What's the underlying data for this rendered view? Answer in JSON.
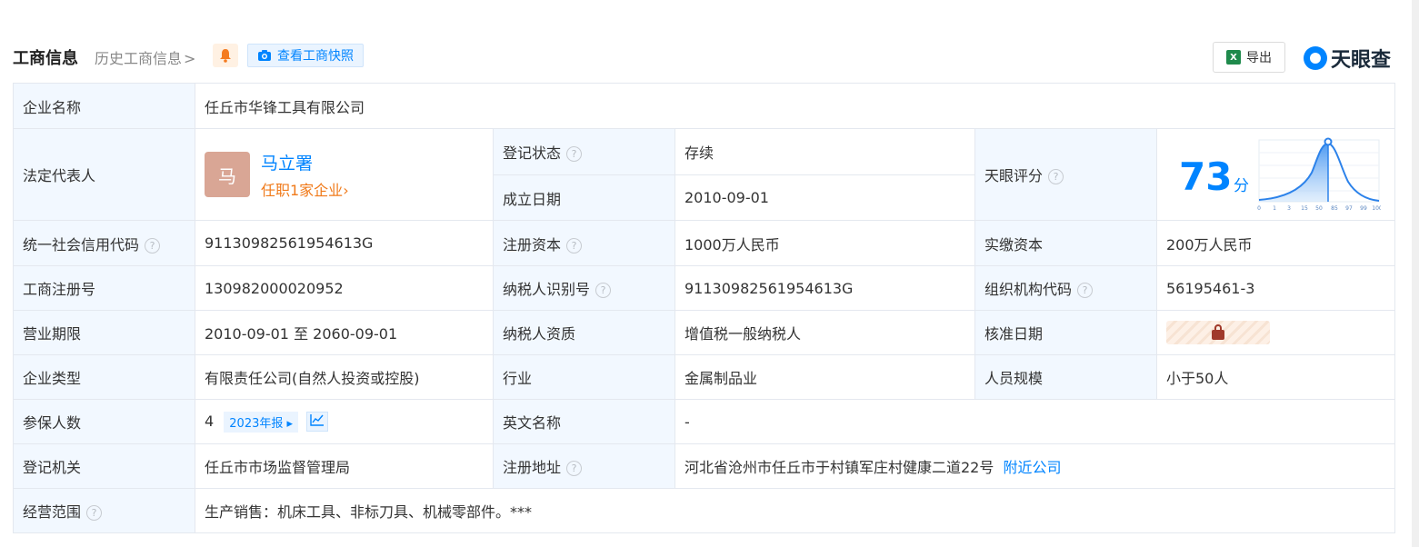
{
  "header": {
    "title": "工商信息",
    "history_label": "历史工商信息",
    "history_chevron": ">",
    "snapshot_label": "查看工商快照",
    "export_label": "导出",
    "brand_name": "天眼查"
  },
  "colors": {
    "accent": "#0084ff",
    "label_bg": "#f2f8ff",
    "status_green": "#1a9a4b",
    "orange": "#f07a1a"
  },
  "fields": {
    "company_name_label": "企业名称",
    "company_name": "任丘市华锋工具有限公司",
    "legal_rep_label": "法定代表人",
    "legal_rep_avatar": "马",
    "legal_rep_name": "马立署",
    "legal_rep_jobs": "任职1家企业",
    "legal_rep_jobs_chevron": "›",
    "reg_status_label": "登记状态",
    "reg_status": "存续",
    "founded_label": "成立日期",
    "founded": "2010-09-01",
    "score_label": "天眼评分",
    "score": "73",
    "score_unit": "分",
    "score_axis": [
      "0",
      "1",
      "3",
      "15",
      "50",
      "85",
      "97",
      "99",
      "100"
    ],
    "credit_code_label": "统一社会信用代码",
    "credit_code": "91130982561954613G",
    "reg_capital_label": "注册资本",
    "reg_capital": "1000万人民币",
    "paid_capital_label": "实缴资本",
    "paid_capital": "200万人民币",
    "reg_no_label": "工商注册号",
    "reg_no": "130982000020952",
    "taxpayer_id_label": "纳税人识别号",
    "taxpayer_id": "91130982561954613G",
    "org_code_label": "组织机构代码",
    "org_code": "56195461-3",
    "term_label": "营业期限",
    "term": "2010-09-01 至 2060-09-01",
    "taxpayer_qual_label": "纳税人资质",
    "taxpayer_qual": "增值税一般纳税人",
    "approve_date_label": "核准日期",
    "company_type_label": "企业类型",
    "company_type": "有限责任公司(自然人投资或控股)",
    "industry_label": "行业",
    "industry": "金属制品业",
    "staff_size_label": "人员规模",
    "staff_size": "小于50人",
    "insured_label": "参保人数",
    "insured": "4",
    "insured_report": "2023年报",
    "english_name_label": "英文名称",
    "english_name": "-",
    "authority_label": "登记机关",
    "authority": "任丘市市场监督管理局",
    "address_label": "注册地址",
    "address": "河北省沧州市任丘市于村镇军庄村健康二道22号",
    "nearby_label": "附近公司",
    "scope_label": "经营范围",
    "scope": "生产销售：机床工具、非标刀具、机械零部件。***"
  }
}
